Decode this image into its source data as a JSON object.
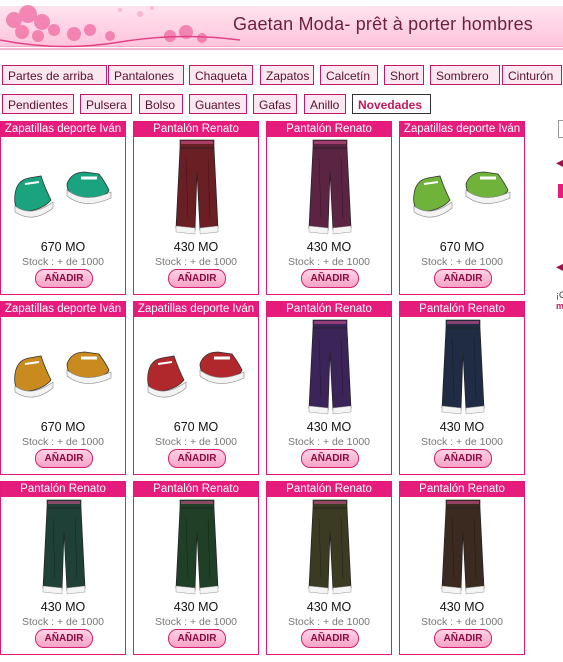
{
  "header": {
    "title": "Gaetan Moda- prêt à porter hombres"
  },
  "categories_row1": [
    "Partes de arriba",
    "Pantalones",
    "Chaqueta",
    "Zapatos",
    "Calcetín",
    "Short",
    "Sombrero",
    "Cinturón"
  ],
  "categories_row2": [
    "Pendientes",
    "Pulsera",
    "Bolso",
    "Guantes",
    "Gafas",
    "Anillo",
    "Novedades"
  ],
  "active_category": "Novedades",
  "products": [
    {
      "name": "Zapatillas deporte Iván",
      "price": "670 MO",
      "stock": "Stock : + de 1000",
      "button": "AÑADIR",
      "kind": "shoe",
      "color": "#1aa37e"
    },
    {
      "name": "Pantalón Renato",
      "price": "430 MO",
      "stock": "Stock : + de 1000",
      "button": "AÑADIR",
      "kind": "pants",
      "color": "#6a1f24"
    },
    {
      "name": "Pantalón Renato",
      "price": "430 MO",
      "stock": "Stock : + de 1000",
      "button": "AÑADIR",
      "kind": "pants",
      "color": "#5a2442"
    },
    {
      "name": "Zapatillas deporte Iván",
      "price": "670 MO",
      "stock": "Stock : + de 1000",
      "button": "AÑADIR",
      "kind": "shoe",
      "color": "#6fb33a"
    },
    {
      "name": "Zapatillas deporte Iván",
      "price": "670 MO",
      "stock": "Stock : + de 1000",
      "button": "AÑADIR",
      "kind": "shoe",
      "color": "#c98a1f"
    },
    {
      "name": "Zapatillas deporte Iván",
      "price": "670 MO",
      "stock": "Stock : + de 1000",
      "button": "AÑADIR",
      "kind": "shoe",
      "color": "#b0282b"
    },
    {
      "name": "Pantalón Renato",
      "price": "430 MO",
      "stock": "Stock : + de 1000",
      "button": "AÑADIR",
      "kind": "pants",
      "color": "#3b2458"
    },
    {
      "name": "Pantalón Renato",
      "price": "430 MO",
      "stock": "Stock : + de 1000",
      "button": "AÑADIR",
      "kind": "pants",
      "color": "#1f2c44"
    },
    {
      "name": "Pantalón Renato",
      "price": "430 MO",
      "stock": "Stock : + de 1000",
      "button": "AÑADIR",
      "kind": "pants",
      "color": "#1f4036"
    },
    {
      "name": "Pantalón Renato",
      "price": "430 MO",
      "stock": "Stock : + de 1000",
      "button": "AÑADIR",
      "kind": "pants",
      "color": "#1f3f26"
    },
    {
      "name": "Pantalón Renato",
      "price": "430 MO",
      "stock": "Stock : + de 1000",
      "button": "AÑADIR",
      "kind": "pants",
      "color": "#3b3a22"
    },
    {
      "name": "Pantalón Renato",
      "price": "430 MO",
      "stock": "Stock : + de 1000",
      "button": "AÑADIR",
      "kind": "pants",
      "color": "#3b2a1f"
    }
  ],
  "side": {
    "text1": "¡G",
    "text2": "m"
  },
  "colors": {
    "accent": "#e61c7c",
    "menu_bg": "#fbe7f0"
  }
}
